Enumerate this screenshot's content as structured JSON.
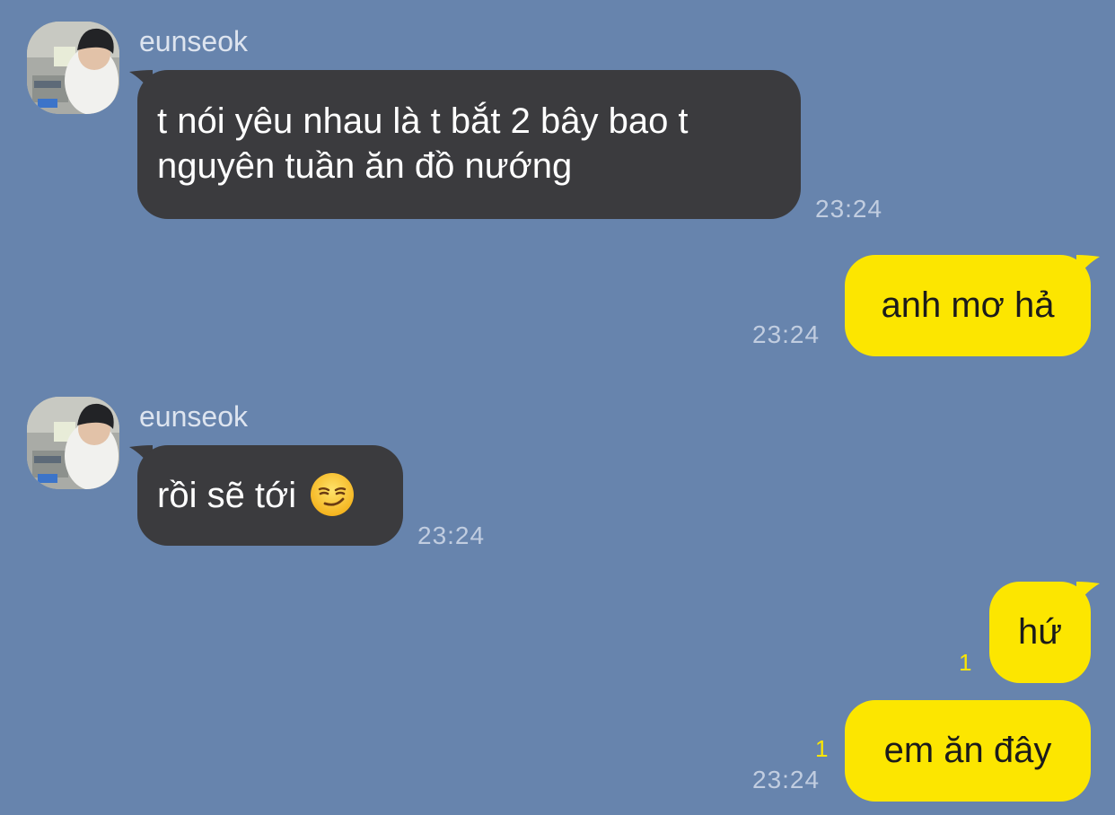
{
  "chat": {
    "contact_name": "eunseok",
    "messages": [
      {
        "direction": "incoming",
        "sender": "eunseok",
        "line1": "t nói yêu nhau là t bắt 2 bây bao t",
        "line2": "nguyên tuần ăn đồ nướng",
        "time": "23:24"
      },
      {
        "direction": "outgoing",
        "text": "anh mơ hả",
        "time": "23:24"
      },
      {
        "direction": "incoming",
        "sender": "eunseok",
        "text": "rồi sẽ tới",
        "emoji": "smirking-face",
        "time": "23:24"
      },
      {
        "direction": "outgoing",
        "text": "hứ",
        "unread_count": "1"
      },
      {
        "direction": "outgoing",
        "text": "em ăn đây",
        "unread_count": "1",
        "time": "23:24"
      }
    ]
  },
  "colors": {
    "background": "#6784ad",
    "incoming_bubble": "#3b3b3e",
    "outgoing_bubble": "#fce600",
    "timestamp": "#c1cde0",
    "unread_badge": "#fce600"
  }
}
